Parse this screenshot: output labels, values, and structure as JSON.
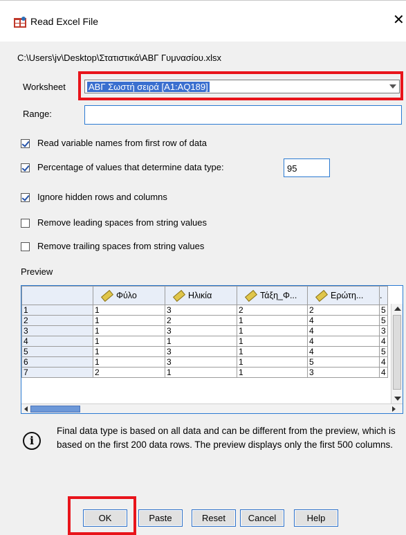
{
  "window": {
    "title": "Read Excel File",
    "close_glyph": "✕"
  },
  "file_path": "C:\\Users\\jv\\Desktop\\Στατιστικά\\ΑΒΓ Γυμνασίου.xlsx",
  "worksheet": {
    "label": "Worksheet",
    "value": "ΑΒΓ Σωστή σειρά [A1:AQ189]"
  },
  "range": {
    "label": "Range:",
    "value": ""
  },
  "options": {
    "read_var_names": {
      "label": "Read variable names from first row of data",
      "checked": true
    },
    "percentage": {
      "label": "Percentage of values that determine data type:",
      "checked": true,
      "value": "95"
    },
    "ignore_hidden": {
      "label": "Ignore hidden rows and columns",
      "checked": true
    },
    "remove_leading": {
      "label": "Remove leading spaces from string values",
      "checked": false
    },
    "remove_trailing": {
      "label": "Remove trailing spaces from string values",
      "checked": false
    }
  },
  "preview": {
    "label": "Preview",
    "columns": [
      "Φύλο",
      "Ηλικία",
      "Τάξη_Φ...",
      "Ερώτη...",
      "."
    ],
    "rows": [
      [
        "1",
        "1",
        "3",
        "2",
        "2",
        "5"
      ],
      [
        "2",
        "1",
        "2",
        "1",
        "4",
        "5"
      ],
      [
        "3",
        "1",
        "3",
        "1",
        "4",
        "3"
      ],
      [
        "4",
        "1",
        "1",
        "1",
        "4",
        "4"
      ],
      [
        "5",
        "1",
        "3",
        "1",
        "4",
        "5"
      ],
      [
        "6",
        "1",
        "3",
        "1",
        "5",
        "4"
      ],
      [
        "7",
        "2",
        "1",
        "1",
        "3",
        "4"
      ]
    ]
  },
  "info": {
    "text": "Final data type is based on all data and can be different from the preview, which is based on the first 200 data rows. The preview displays only the first 500 columns."
  },
  "buttons": {
    "ok": "OK",
    "paste": "Paste",
    "reset": "Reset",
    "cancel": "Cancel",
    "help": "Help"
  },
  "colors": {
    "highlight_box": "#e8141b",
    "focus_border": "#2a7ad2"
  }
}
